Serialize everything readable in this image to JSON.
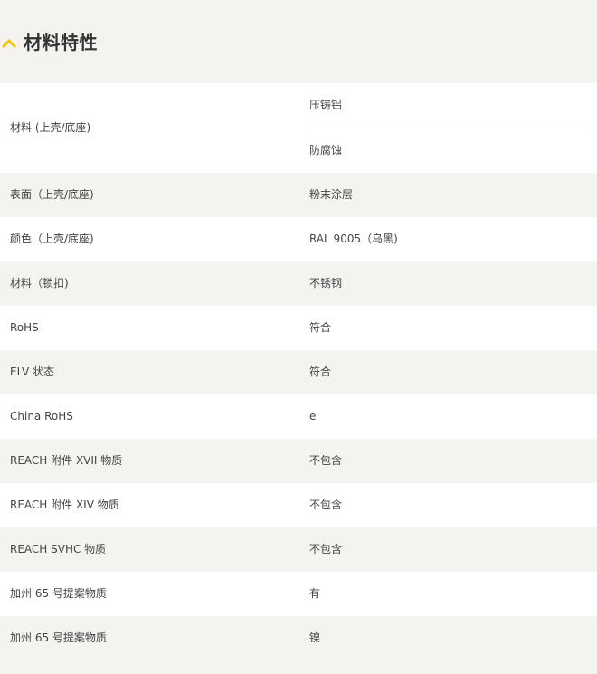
{
  "section": {
    "title": "材料特性",
    "icon": "chevron-up-icon",
    "accent_color": "#f5c400"
  },
  "rows": [
    {
      "label": "材料 (上壳/底座)",
      "values": [
        "压铸铝",
        "防腐蚀"
      ]
    },
    {
      "label": "表面（上壳/底座)",
      "values": [
        "粉末涂层"
      ]
    },
    {
      "label": "颜色（上壳/底座)",
      "values": [
        "RAL 9005（乌黑)"
      ]
    },
    {
      "label": "材料（锁扣)",
      "values": [
        "不锈钢"
      ]
    },
    {
      "label": "RoHS",
      "values": [
        "符合"
      ]
    },
    {
      "label": "ELV 状态",
      "values": [
        "符合"
      ]
    },
    {
      "label": "China RoHS",
      "values": [
        "e"
      ]
    },
    {
      "label": "REACH 附件 XVII 物质",
      "values": [
        "不包含"
      ]
    },
    {
      "label": "REACH 附件 XIV 物质",
      "values": [
        "不包含"
      ]
    },
    {
      "label": "REACH SVHC 物质",
      "values": [
        "不包含"
      ]
    },
    {
      "label": "加州 65 号提案物质",
      "values": [
        "有"
      ]
    },
    {
      "label": "加州 65 号提案物质",
      "values": [
        "镍"
      ]
    }
  ]
}
